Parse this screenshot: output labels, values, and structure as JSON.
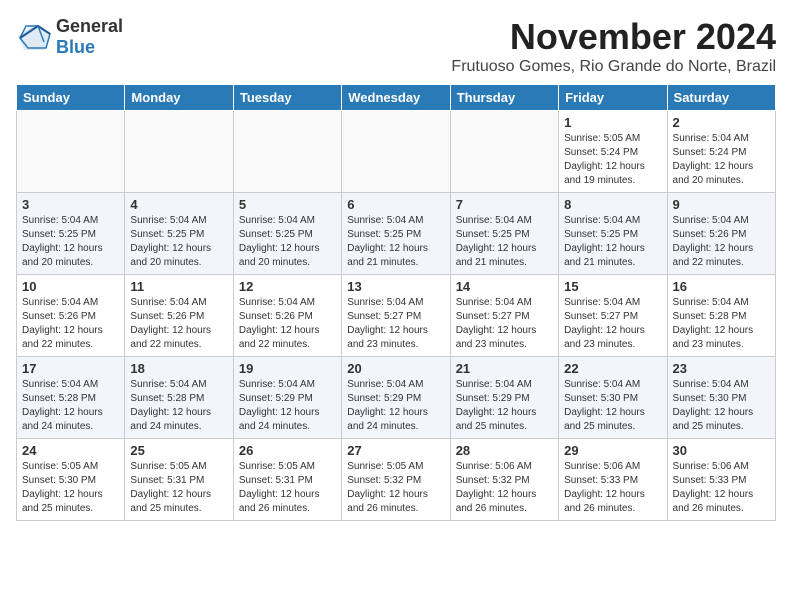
{
  "header": {
    "logo_general": "General",
    "logo_blue": "Blue",
    "month": "November 2024",
    "location": "Frutuoso Gomes, Rio Grande do Norte, Brazil"
  },
  "weekdays": [
    "Sunday",
    "Monday",
    "Tuesday",
    "Wednesday",
    "Thursday",
    "Friday",
    "Saturday"
  ],
  "weeks": [
    [
      {
        "day": "",
        "info": ""
      },
      {
        "day": "",
        "info": ""
      },
      {
        "day": "",
        "info": ""
      },
      {
        "day": "",
        "info": ""
      },
      {
        "day": "",
        "info": ""
      },
      {
        "day": "1",
        "info": "Sunrise: 5:05 AM\nSunset: 5:24 PM\nDaylight: 12 hours and 19 minutes."
      },
      {
        "day": "2",
        "info": "Sunrise: 5:04 AM\nSunset: 5:24 PM\nDaylight: 12 hours and 20 minutes."
      }
    ],
    [
      {
        "day": "3",
        "info": "Sunrise: 5:04 AM\nSunset: 5:25 PM\nDaylight: 12 hours and 20 minutes."
      },
      {
        "day": "4",
        "info": "Sunrise: 5:04 AM\nSunset: 5:25 PM\nDaylight: 12 hours and 20 minutes."
      },
      {
        "day": "5",
        "info": "Sunrise: 5:04 AM\nSunset: 5:25 PM\nDaylight: 12 hours and 20 minutes."
      },
      {
        "day": "6",
        "info": "Sunrise: 5:04 AM\nSunset: 5:25 PM\nDaylight: 12 hours and 21 minutes."
      },
      {
        "day": "7",
        "info": "Sunrise: 5:04 AM\nSunset: 5:25 PM\nDaylight: 12 hours and 21 minutes."
      },
      {
        "day": "8",
        "info": "Sunrise: 5:04 AM\nSunset: 5:25 PM\nDaylight: 12 hours and 21 minutes."
      },
      {
        "day": "9",
        "info": "Sunrise: 5:04 AM\nSunset: 5:26 PM\nDaylight: 12 hours and 22 minutes."
      }
    ],
    [
      {
        "day": "10",
        "info": "Sunrise: 5:04 AM\nSunset: 5:26 PM\nDaylight: 12 hours and 22 minutes."
      },
      {
        "day": "11",
        "info": "Sunrise: 5:04 AM\nSunset: 5:26 PM\nDaylight: 12 hours and 22 minutes."
      },
      {
        "day": "12",
        "info": "Sunrise: 5:04 AM\nSunset: 5:26 PM\nDaylight: 12 hours and 22 minutes."
      },
      {
        "day": "13",
        "info": "Sunrise: 5:04 AM\nSunset: 5:27 PM\nDaylight: 12 hours and 23 minutes."
      },
      {
        "day": "14",
        "info": "Sunrise: 5:04 AM\nSunset: 5:27 PM\nDaylight: 12 hours and 23 minutes."
      },
      {
        "day": "15",
        "info": "Sunrise: 5:04 AM\nSunset: 5:27 PM\nDaylight: 12 hours and 23 minutes."
      },
      {
        "day": "16",
        "info": "Sunrise: 5:04 AM\nSunset: 5:28 PM\nDaylight: 12 hours and 23 minutes."
      }
    ],
    [
      {
        "day": "17",
        "info": "Sunrise: 5:04 AM\nSunset: 5:28 PM\nDaylight: 12 hours and 24 minutes."
      },
      {
        "day": "18",
        "info": "Sunrise: 5:04 AM\nSunset: 5:28 PM\nDaylight: 12 hours and 24 minutes."
      },
      {
        "day": "19",
        "info": "Sunrise: 5:04 AM\nSunset: 5:29 PM\nDaylight: 12 hours and 24 minutes."
      },
      {
        "day": "20",
        "info": "Sunrise: 5:04 AM\nSunset: 5:29 PM\nDaylight: 12 hours and 24 minutes."
      },
      {
        "day": "21",
        "info": "Sunrise: 5:04 AM\nSunset: 5:29 PM\nDaylight: 12 hours and 25 minutes."
      },
      {
        "day": "22",
        "info": "Sunrise: 5:04 AM\nSunset: 5:30 PM\nDaylight: 12 hours and 25 minutes."
      },
      {
        "day": "23",
        "info": "Sunrise: 5:04 AM\nSunset: 5:30 PM\nDaylight: 12 hours and 25 minutes."
      }
    ],
    [
      {
        "day": "24",
        "info": "Sunrise: 5:05 AM\nSunset: 5:30 PM\nDaylight: 12 hours and 25 minutes."
      },
      {
        "day": "25",
        "info": "Sunrise: 5:05 AM\nSunset: 5:31 PM\nDaylight: 12 hours and 25 minutes."
      },
      {
        "day": "26",
        "info": "Sunrise: 5:05 AM\nSunset: 5:31 PM\nDaylight: 12 hours and 26 minutes."
      },
      {
        "day": "27",
        "info": "Sunrise: 5:05 AM\nSunset: 5:32 PM\nDaylight: 12 hours and 26 minutes."
      },
      {
        "day": "28",
        "info": "Sunrise: 5:06 AM\nSunset: 5:32 PM\nDaylight: 12 hours and 26 minutes."
      },
      {
        "day": "29",
        "info": "Sunrise: 5:06 AM\nSunset: 5:33 PM\nDaylight: 12 hours and 26 minutes."
      },
      {
        "day": "30",
        "info": "Sunrise: 5:06 AM\nSunset: 5:33 PM\nDaylight: 12 hours and 26 minutes."
      }
    ]
  ]
}
